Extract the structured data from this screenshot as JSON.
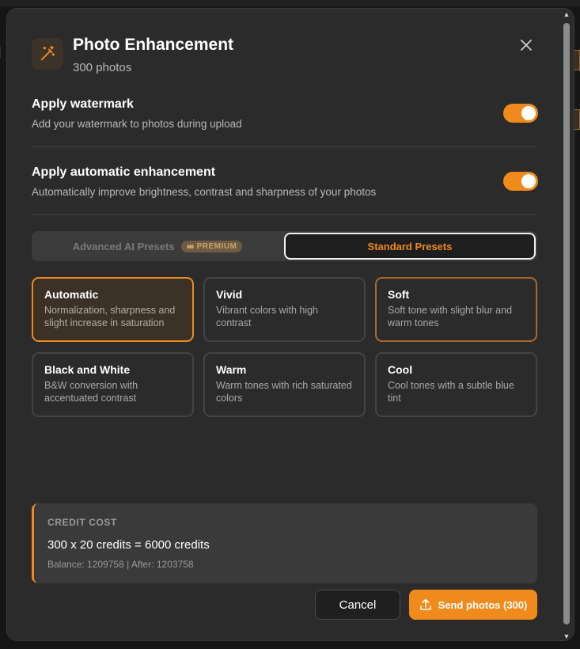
{
  "header": {
    "title": "Photo Enhancement",
    "subtitle": "300 photos"
  },
  "settings": [
    {
      "title": "Apply watermark",
      "description": "Add your watermark to photos during upload",
      "enabled": true
    },
    {
      "title": "Apply automatic enhancement",
      "description": "Automatically improve brightness, contrast and sharpness of your photos",
      "enabled": true
    }
  ],
  "tabs": {
    "advanced_label": "Advanced AI Presets",
    "premium_badge": "PREMIUM",
    "standard_label": "Standard Presets",
    "active": "standard"
  },
  "presets": [
    {
      "title": "Automatic",
      "description": "Normalization, sharpness and slight increase in saturation",
      "selected": true
    },
    {
      "title": "Vivid",
      "description": "Vibrant colors with high contrast",
      "selected": false
    },
    {
      "title": "Soft",
      "description": "Soft tone with slight blur and warm tones",
      "selected": false
    },
    {
      "title": "Black and White",
      "description": "B&W conversion with accentuated contrast",
      "selected": false
    },
    {
      "title": "Warm",
      "description": "Warm tones with rich saturated colors",
      "selected": false
    },
    {
      "title": "Cool",
      "description": "Cool tones with a subtle blue tint",
      "selected": false
    }
  ],
  "credit": {
    "label": "CREDIT COST",
    "calculation": "300 x 20 credits = 6000 credits",
    "balance": "Balance: 1209758 | After: 1203758"
  },
  "footer": {
    "cancel_label": "Cancel",
    "send_label": "Send photos (300)"
  },
  "colors": {
    "accent": "#f08a1c",
    "modal_bg": "#2b2b2c",
    "card_border": "#444446"
  },
  "icons": {
    "header": "magic-wand-icon",
    "close": "close-icon",
    "premium": "crown-icon",
    "send": "upload-icon"
  }
}
